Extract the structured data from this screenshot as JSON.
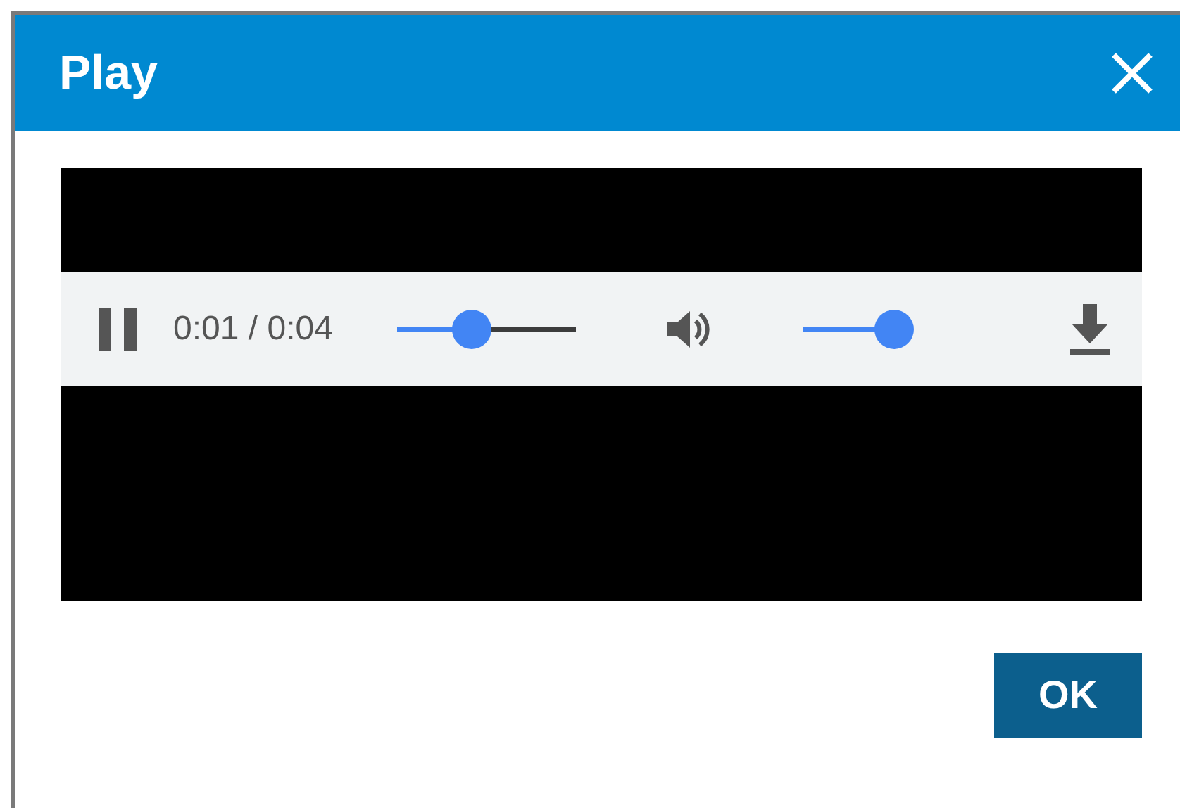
{
  "dialog": {
    "title": "Play"
  },
  "player": {
    "playing": true,
    "time": "0:01 / 0:04",
    "progress": {
      "level": 0.41
    },
    "volume": {
      "level": 0.85
    }
  },
  "buttons": [
    {
      "label": "OK"
    }
  ]
}
